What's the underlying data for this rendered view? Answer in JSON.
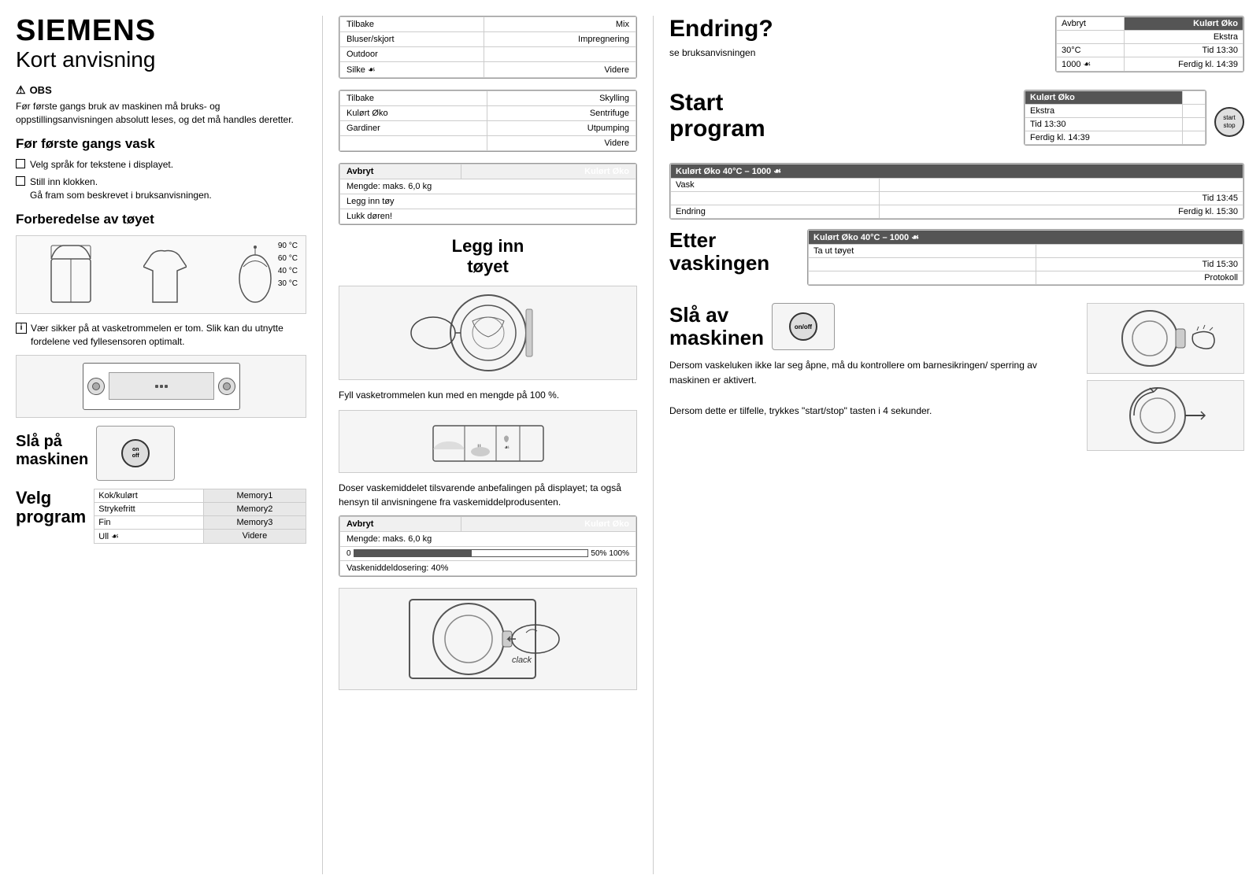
{
  "brand": "SIEMENS",
  "title": "Kort anvisning",
  "obs": {
    "heading": "OBS",
    "text": "Før første gangs bruk av maskinen må bruks- og oppstillingsanvisningen absolutt leses, og det må handles deretter."
  },
  "before_first_wash": {
    "heading": "Før første gangs vask",
    "steps": [
      "Velg språk for tekstene i displayet.",
      "Still inn klokken.\nGå fram som beskrevet i bruksanvisningen."
    ]
  },
  "prep": {
    "heading": "Forberedelse av tøyet",
    "temps": [
      "90 °C",
      "60 °C",
      "40 °C",
      "30 °C"
    ],
    "info": "Vær sikker på at vasketrommelen er tom. Slik kan du utnytte fordelene ved fyllesensoren optimalt."
  },
  "power_on": {
    "heading": "Slå på\nmaskinen",
    "button_labels": [
      "on",
      "off"
    ]
  },
  "select_program": {
    "heading": "Velg\nprogram",
    "programs": [
      {
        "name": "Kok/kulørt",
        "memory": "Memory1"
      },
      {
        "name": "Strykefritt",
        "memory": "Memory2"
      },
      {
        "name": "Fin",
        "memory": "Memory3"
      },
      {
        "name": "Ull ☙",
        "memory": "Videre"
      }
    ]
  },
  "screens": {
    "screen1": {
      "rows": [
        {
          "left": "Tilbake",
          "right": "Mix"
        },
        {
          "left": "Bluser/skjort",
          "right": "Impregnering"
        },
        {
          "left": "Outdoor",
          "right": ""
        },
        {
          "left": "Silke ☙",
          "right": "Videre"
        }
      ]
    },
    "screen2": {
      "rows": [
        {
          "left": "Tilbake",
          "right": "Skylling"
        },
        {
          "left": "Kulørt Øko",
          "right": "Sentrifuge"
        },
        {
          "left": "Gardiner",
          "right": "Utpumping"
        },
        {
          "left": "",
          "right": "Videre"
        }
      ]
    },
    "screen3": {
      "header": {
        "left": "Avbryt",
        "right": "Kulørt Øko"
      },
      "rows": [
        "Mengde: maks. 6,0 kg",
        "Legg inn tøy",
        "Lukk døren!"
      ]
    },
    "screen4": {
      "header": {
        "left": "Avbryt",
        "right": "Kulørt Øko"
      },
      "rows": [
        {
          "left": "Mengde: maks. 6,0 kg",
          "right": ""
        },
        {
          "left": "0",
          "mid": "50%",
          "right": "100%"
        },
        {
          "left": "Vaskeniddeldosering: 40%",
          "right": ""
        }
      ]
    }
  },
  "load_drum": {
    "heading": "Legg inn\ntøyet",
    "text1": "Fyll vasketrommelen kun med en mengde på 100 %.",
    "text2": "Doser vaskemiddelet tilsvarende anbefalingen på displayet; ta også hensyn til anvisningene fra vaskemiddelprodusenten."
  },
  "change_section": {
    "heading": "Endring?",
    "subtext": "se bruksanvisningen",
    "panel": {
      "rows": [
        {
          "left": "Avbryt",
          "right": "Kulørt Øko",
          "rightDark": true
        },
        {
          "left": "",
          "right": "Ekstra"
        },
        {
          "left": "30°C",
          "right": "Tid 13:30"
        },
        {
          "left": "1000 ☙",
          "right": "Ferdig kl. 14:39"
        }
      ]
    }
  },
  "start_program": {
    "heading": "Start\nprogram",
    "panel": {
      "rows": [
        {
          "left": "Kulørt Øko",
          "right": "",
          "leftDark": true
        },
        {
          "left": "Ekstra",
          "right": ""
        },
        {
          "left": "Tid 13:30",
          "right": ""
        },
        {
          "left": "Ferdig kl. 14:39",
          "right": ""
        }
      ]
    },
    "button": {
      "label1": "start",
      "label2": "stop"
    }
  },
  "during_wash": {
    "panel": {
      "header": "Kulørt Øko 40°C – 1000 ☙",
      "rows": [
        {
          "label": "Vask"
        },
        {
          "label": "",
          "right": "Tid 13:45"
        },
        {
          "label": "Endring",
          "right": "Ferdig kl. 15:30"
        }
      ]
    }
  },
  "after_wash": {
    "heading": "Etter\nvaskingen",
    "panel": {
      "header": "Kulørt Øko 40°C – 1000 ☙",
      "rows": [
        {
          "label": "Ta ut tøyet"
        },
        {
          "label": "",
          "right": "Tid 15:30"
        },
        {
          "label": "",
          "right": "Protokoll"
        }
      ]
    },
    "text": "Dersom vaskeluken ikke lar seg åpne, må du kontrollere om barnesikringen/sperring av maskinen er aktivert.\n\nDersom dette er tilfelle, trykkes \"start/stop\" tasten i 4 sekunder."
  },
  "turn_off": {
    "heading": "Slå av\nmaskinen",
    "button": {
      "label1": "on/off"
    }
  },
  "door_sound": {
    "label": "clack"
  }
}
